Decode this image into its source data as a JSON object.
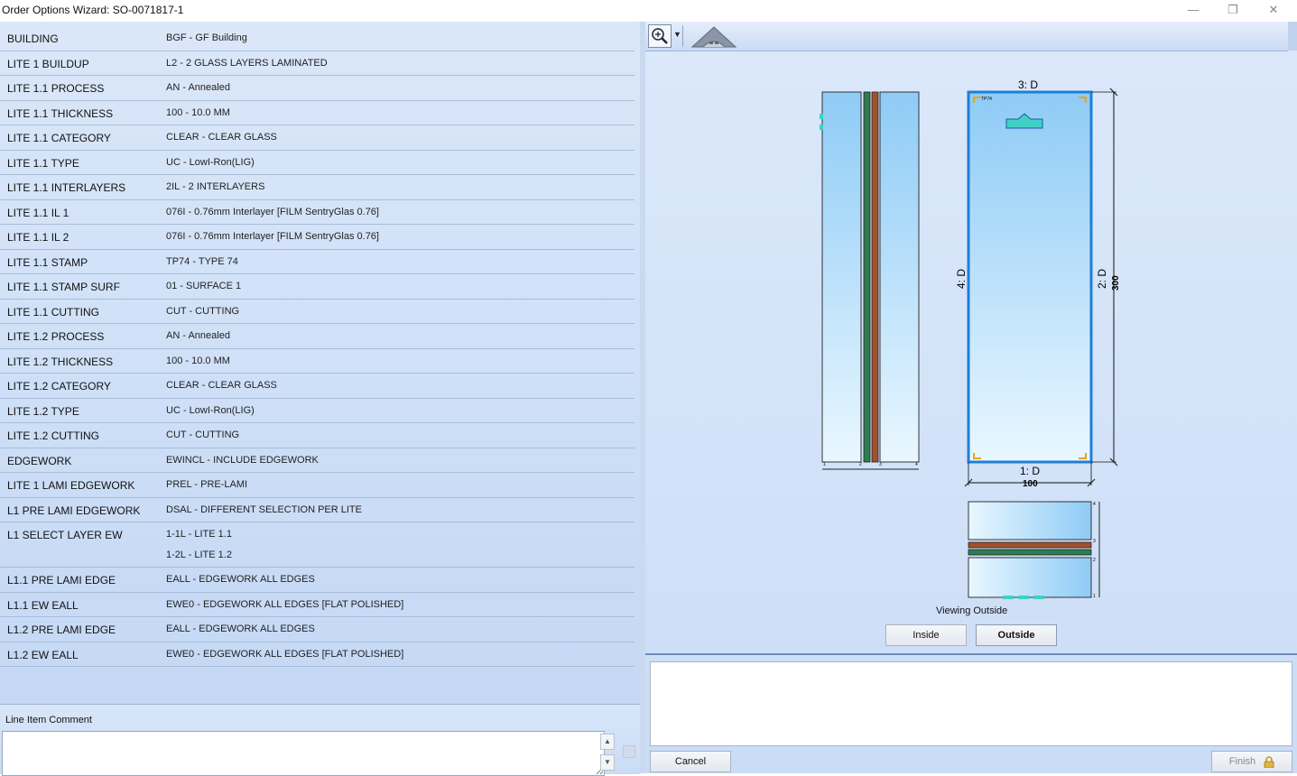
{
  "window": {
    "title": "Order Options Wizard: SO-0071817-1",
    "minimize_glyph": "—",
    "restore_glyph": "❐",
    "close_glyph": "✕"
  },
  "options": [
    {
      "key": "BUILDING",
      "value": "BGF - GF Building"
    },
    {
      "key": "LITE 1 BUILDUP",
      "value": "L2 - 2 GLASS LAYERS LAMINATED"
    },
    {
      "key": "LITE 1.1 PROCESS",
      "value": "AN - Annealed"
    },
    {
      "key": "LITE 1.1 THICKNESS",
      "value": "100 - 10.0 MM"
    },
    {
      "key": "LITE 1.1 CATEGORY",
      "value": "CLEAR - CLEAR GLASS"
    },
    {
      "key": "LITE 1.1 TYPE",
      "value": "UC - LowI-Ron(LIG)"
    },
    {
      "key": "LITE 1.1 INTERLAYERS",
      "value": "2IL - 2 INTERLAYERS"
    },
    {
      "key": "LITE 1.1 IL 1",
      "value": "076I - 0.76mm Interlayer [FILM SentryGlas 0.76]"
    },
    {
      "key": "LITE 1.1 IL 2",
      "value": "076I - 0.76mm Interlayer [FILM SentryGlas 0.76]"
    },
    {
      "key": "LITE 1.1 STAMP",
      "value": "TP74 - TYPE 74"
    },
    {
      "key": "LITE 1.1 STAMP SURF",
      "value": "01 - SURFACE 1"
    },
    {
      "key": "LITE 1.1 CUTTING",
      "value": "CUT - CUTTING"
    },
    {
      "key": "LITE 1.2 PROCESS",
      "value": "AN - Annealed"
    },
    {
      "key": "LITE 1.2 THICKNESS",
      "value": "100 - 10.0 MM"
    },
    {
      "key": "LITE 1.2 CATEGORY",
      "value": "CLEAR - CLEAR GLASS"
    },
    {
      "key": "LITE 1.2 TYPE",
      "value": "UC - LowI-Ron(LIG)"
    },
    {
      "key": "LITE 1.2 CUTTING",
      "value": "CUT - CUTTING"
    },
    {
      "key": "EDGEWORK",
      "value": "EWINCL - INCLUDE EDGEWORK"
    },
    {
      "key": "LITE 1 LAMI EDGEWORK",
      "value": "PREL - PRE-LAMI"
    },
    {
      "key": "L1 PRE LAMI EDGEWORK",
      "value": "DSAL - DIFFERENT SELECTION PER LITE"
    },
    {
      "key": "L1 SELECT LAYER EW",
      "value": "1-1L - LITE 1.1",
      "value2": "1-2L - LITE 1.2"
    },
    {
      "key": "L1.1 PRE LAMI EDGE",
      "value": "EALL - EDGEWORK ALL EDGES"
    },
    {
      "key": "L1.1 EW EALL",
      "value": "EWE0 - EDGEWORK ALL EDGES [FLAT POLISHED]"
    },
    {
      "key": "L1.2 PRE LAMI EDGE",
      "value": "EALL - EDGEWORK ALL EDGES"
    },
    {
      "key": "L1.2 EW EALL",
      "value": "EWE0 - EDGEWORK ALL EDGES [FLAT POLISHED]"
    }
  ],
  "comment": {
    "label": "Line Item Comment",
    "value": ""
  },
  "toolbar": {
    "zoom_icon": "zoom-in-icon",
    "house_icon": "house-view-icon"
  },
  "drawing": {
    "edge_top": "3: D",
    "edge_bottom": "1: D",
    "edge_left": "4: D",
    "edge_right": "2: D",
    "width_dim": "100",
    "height_dim": "300",
    "stamp": "TP74",
    "side_labels": [
      "1",
      "2",
      "3",
      "4"
    ],
    "viewing": "Viewing Outside",
    "colors": {
      "glass": "#8ecbf6",
      "interlayer_a": "#2e7d52",
      "interlayer_b": "#a0522d",
      "corner": "#e8a317",
      "stamp": "#3fd1c3",
      "frame": "#1e7fd6"
    }
  },
  "buttons": {
    "inside": "Inside",
    "outside": "Outside",
    "cancel": "Cancel",
    "finish": "Finish"
  }
}
